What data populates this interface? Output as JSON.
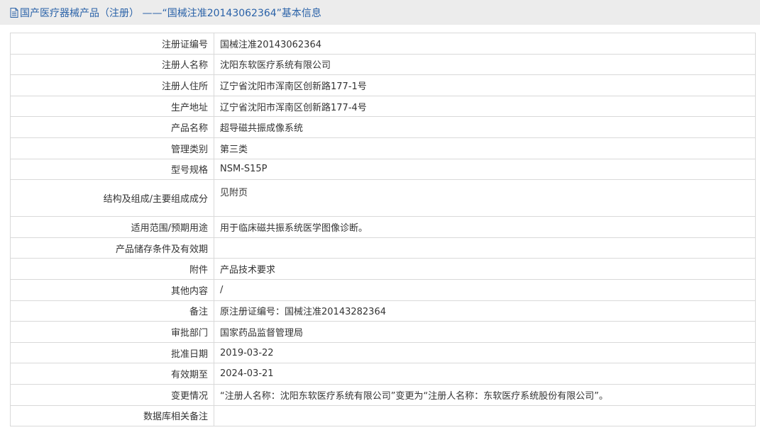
{
  "header": {
    "icon": "document-icon",
    "title": "国产医疗器械产品（注册） ——“国械注准20143062364”基本信息",
    "color": "#2a62a8"
  },
  "rows": [
    {
      "label": "注册证编号",
      "value": "国械注准20143062364"
    },
    {
      "label": "注册人名称",
      "value": "沈阳东软医疗系统有限公司"
    },
    {
      "label": "注册人住所",
      "value": "辽宁省沈阳市浑南区创新路177-1号"
    },
    {
      "label": "生产地址",
      "value": "辽宁省沈阳市浑南区创新路177-4号"
    },
    {
      "label": "产品名称",
      "value": "超导磁共振成像系统"
    },
    {
      "label": "管理类别",
      "value": "第三类"
    },
    {
      "label": "型号规格",
      "value": "NSM-S15P"
    },
    {
      "label": "结构及组成/主要组成成分",
      "value": "见附页"
    },
    {
      "label": "适用范围/预期用途",
      "value": "用于临床磁共振系统医学图像诊断。"
    },
    {
      "label": "产品储存条件及有效期",
      "value": ""
    },
    {
      "label": "附件",
      "value": "产品技术要求"
    },
    {
      "label": "其他内容",
      "value": "/"
    },
    {
      "label": "备注",
      "value": "原注册证编号：国械注准20143282364"
    },
    {
      "label": "审批部门",
      "value": "国家药品监督管理局"
    },
    {
      "label": "批准日期",
      "value": "2019-03-22"
    },
    {
      "label": "有效期至",
      "value": "2024-03-21"
    },
    {
      "label": "变更情况",
      "value": "“注册人名称：沈阳东软医疗系统有限公司”变更为“注册人名称：东软医疗系统股份有限公司”。"
    },
    {
      "label": "数据库相关备注",
      "value": ""
    }
  ]
}
